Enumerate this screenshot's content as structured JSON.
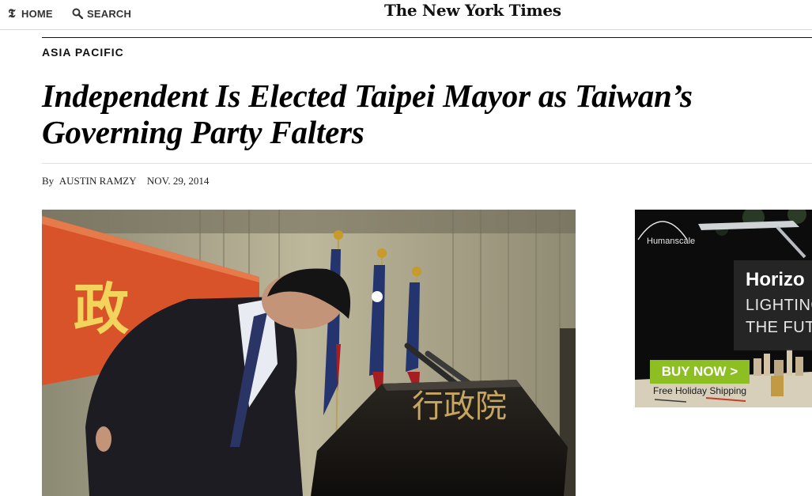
{
  "nav": {
    "home_label": "HOME",
    "search_label": "SEARCH"
  },
  "masthead": {
    "logo_text": "The New York Times"
  },
  "article": {
    "section": "ASIA PACIFIC",
    "headline": "Independent Is Elected Taipei Mayor as Taiwan’s Governing Party Falters",
    "byline_prefix": "By",
    "author": "AUSTIN RAMZY",
    "date": "NOV. 29, 2014"
  },
  "photo": {
    "podium_text": "行政院",
    "banner_text": "政"
  },
  "ad": {
    "brand": "Humanscale",
    "title": "Horizo",
    "line1": "LIGHTING",
    "line2": "THE FUT",
    "cta_label": "BUY NOW >",
    "shipping": "Free Holiday Shipping",
    "colors": {
      "cta": "#8dbf22",
      "background": "#0c0c0c"
    }
  }
}
